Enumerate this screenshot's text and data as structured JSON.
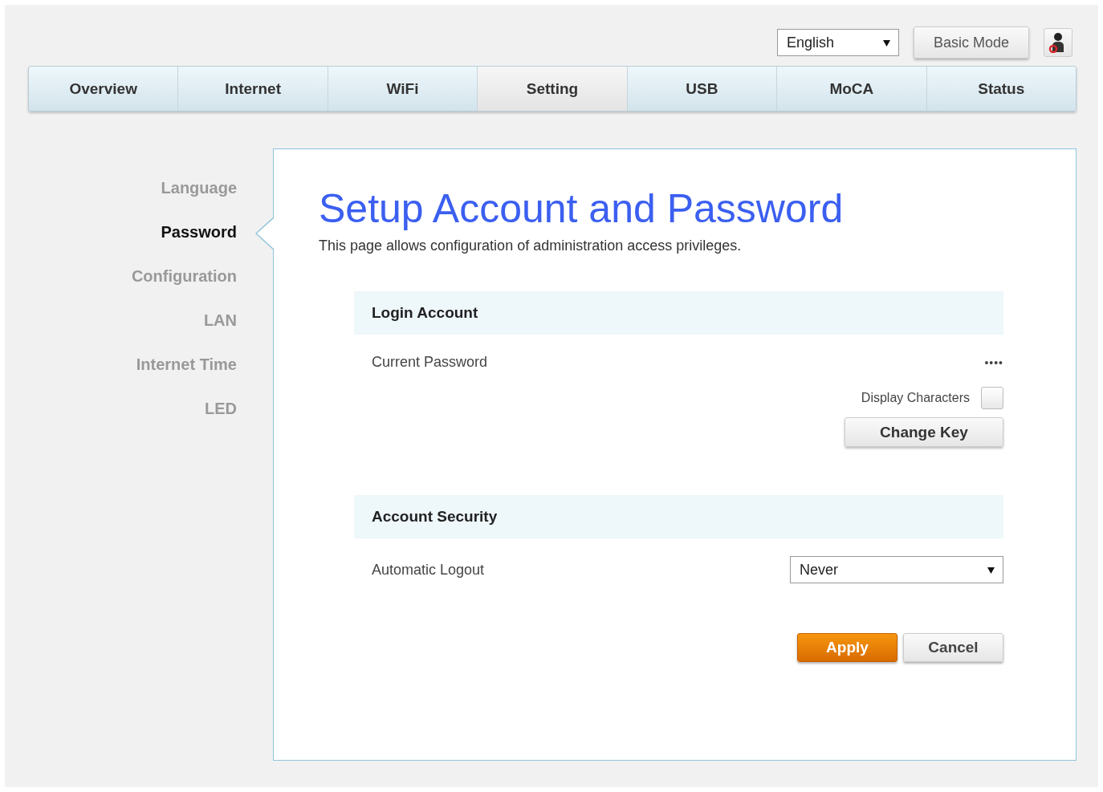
{
  "header": {
    "language": "English",
    "mode_button": "Basic Mode"
  },
  "tabs": [
    {
      "label": "Overview",
      "selected": false
    },
    {
      "label": "Internet",
      "selected": false
    },
    {
      "label": "WiFi",
      "selected": false
    },
    {
      "label": "Setting",
      "selected": true
    },
    {
      "label": "USB",
      "selected": false
    },
    {
      "label": "MoCA",
      "selected": false
    },
    {
      "label": "Status",
      "selected": false
    }
  ],
  "sidebar": {
    "items": [
      {
        "label": "Language",
        "selected": false
      },
      {
        "label": "Password",
        "selected": true
      },
      {
        "label": "Configuration",
        "selected": false
      },
      {
        "label": "LAN",
        "selected": false
      },
      {
        "label": "Internet Time",
        "selected": false
      },
      {
        "label": "LED",
        "selected": false
      }
    ]
  },
  "page": {
    "title": "Setup Account and Password",
    "description": "This page allows configuration of administration access privileges."
  },
  "login_account": {
    "heading": "Login Account",
    "current_password_label": "Current Password",
    "current_password": "••••",
    "display_characters": {
      "label": "Display Characters",
      "checked": false
    },
    "change_key_button": "Change Key"
  },
  "account_security": {
    "heading": "Account Security",
    "automatic_logout_label": "Automatic Logout",
    "automatic_logout": "Never"
  },
  "buttons": [
    {
      "label": "Apply",
      "kind": "primary"
    },
    {
      "label": "Cancel",
      "kind": "secondary"
    }
  ]
}
